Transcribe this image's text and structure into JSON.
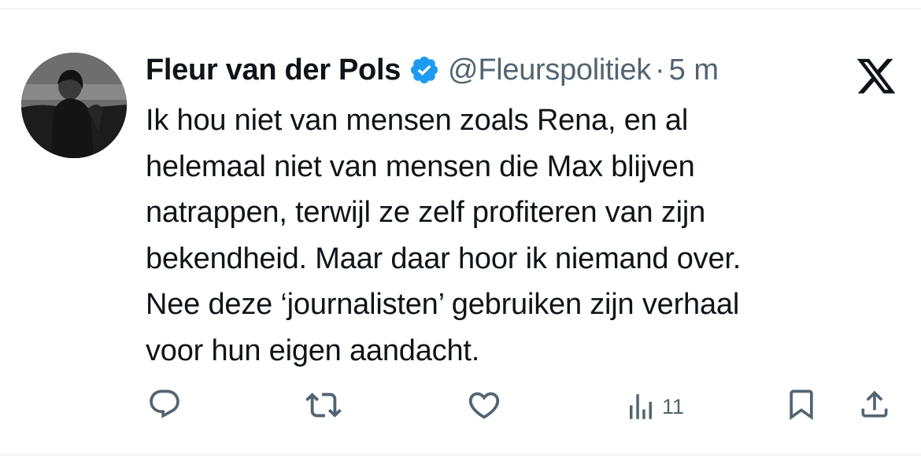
{
  "author": {
    "display_name": "Fleur van der Pols",
    "handle": "@Fleurspolitiek",
    "separator": "·",
    "time": "5 m",
    "verified": true
  },
  "brand": {
    "logo_icon": "x-logo-icon"
  },
  "tweet": {
    "lines": [
      "Ik hou niet van mensen zoals Rena, en al",
      "helemaal niet van mensen die Max blijven",
      "natrappen, terwijl ze zelf profiteren van zijn",
      "bekendheid. Maar daar hoor ik niemand over.",
      "Nee deze ‘journalisten’ gebruiken zijn verhaal",
      "voor hun eigen aandacht."
    ]
  },
  "actions": {
    "reply_icon": "reply-icon",
    "retweet_icon": "retweet-icon",
    "like_icon": "heart-icon",
    "views_icon": "views-icon",
    "views_count": "11",
    "bookmark_icon": "bookmark-icon",
    "share_icon": "share-icon"
  },
  "colors": {
    "text": "#0f1419",
    "secondary": "#536471",
    "verified_blue": "#1d9bf0",
    "divider": "#eff3f4"
  }
}
